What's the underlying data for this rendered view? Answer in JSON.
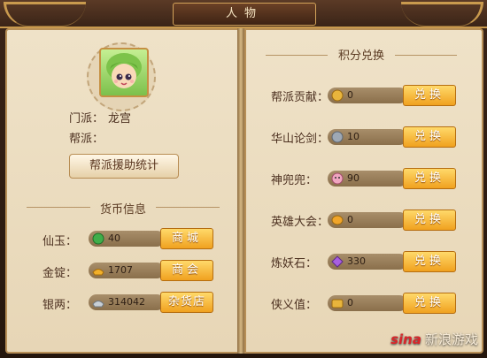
{
  "window": {
    "title": "人物"
  },
  "profile": {
    "sect_label": "门派：",
    "sect_value": "龙宫",
    "clan_label": "帮派：",
    "clan_value": "",
    "stats_button": "帮派援助统计"
  },
  "currency": {
    "header": "货币信息",
    "rows": [
      {
        "label": "仙玉：",
        "value": "40",
        "button": "商城",
        "icon": "green-jade-icon",
        "color": "#3fae4a"
      },
      {
        "label": "金锭：",
        "value": "1707",
        "button": "商会",
        "icon": "gold-ingot-icon",
        "color": "#f2b02a"
      },
      {
        "label": "银两：",
        "value": "314042",
        "button": "杂货店",
        "icon": "silver-ingot-icon",
        "color": "#bfc6cd"
      }
    ]
  },
  "points": {
    "header": "积分兑换",
    "rows": [
      {
        "label": "帮派贡献：",
        "value": "0",
        "button": "兑换",
        "icon": "contribution-coin-icon",
        "color": "#e8b53c"
      },
      {
        "label": "华山论剑：",
        "value": "10",
        "button": "兑换",
        "icon": "sword-coin-icon",
        "color": "#9ea8b4"
      },
      {
        "label": "神兜兜：",
        "value": "90",
        "button": "兑换",
        "icon": "pet-face-icon",
        "color": "#f0a5c0"
      },
      {
        "label": "英雄大会：",
        "value": "0",
        "button": "兑换",
        "icon": "hero-coin-icon",
        "color": "#f0a52a"
      },
      {
        "label": "炼妖石：",
        "value": "330",
        "button": "兑换",
        "icon": "purple-gem-icon",
        "color": "#a85fe0"
      },
      {
        "label": "侠义值：",
        "value": "0",
        "button": "兑换",
        "icon": "chivalry-scroll-icon",
        "color": "#e8b53c"
      }
    ]
  },
  "watermark": {
    "brand": "sina",
    "text": "新浪游戏"
  }
}
